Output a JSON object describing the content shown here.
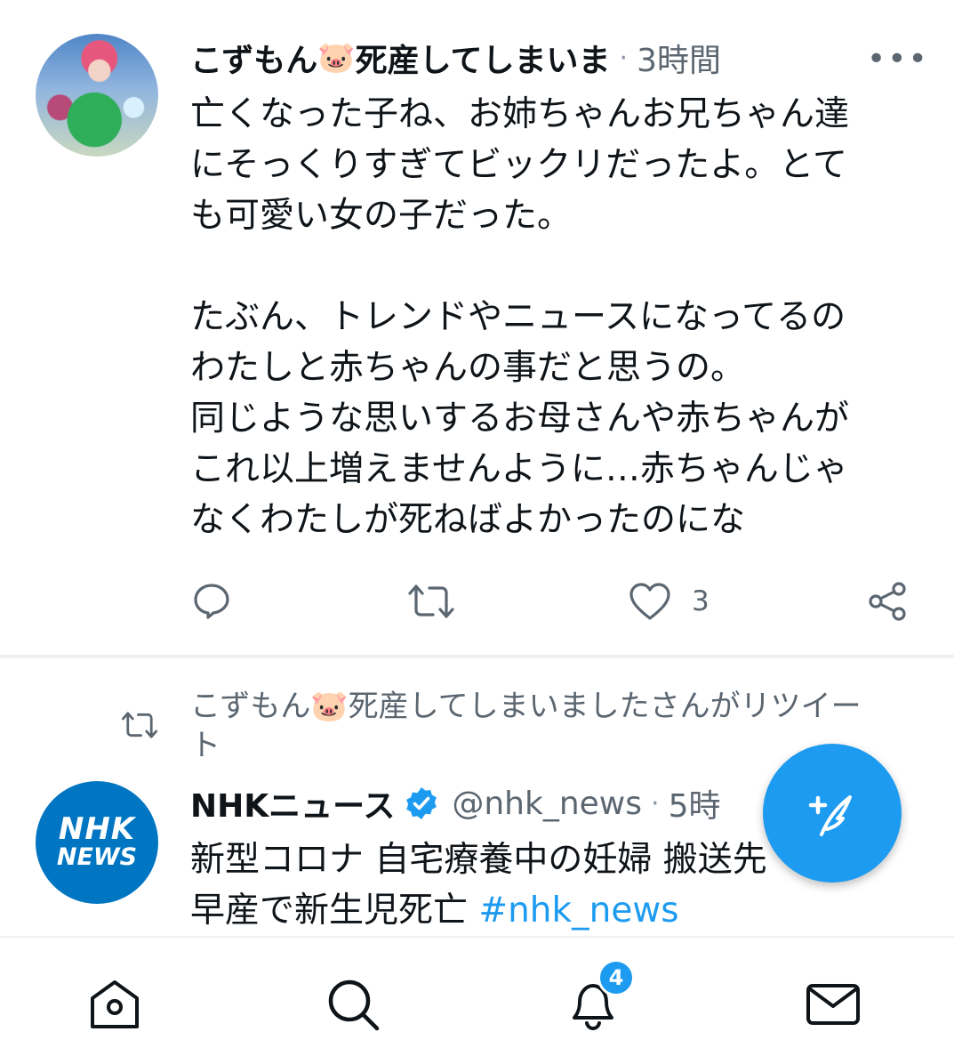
{
  "tweet1": {
    "display_name": "こずもん",
    "name_emoji": "🐷",
    "name_suffix": "死産してしまいま",
    "separator": "·",
    "time": "3時間",
    "more": "•••",
    "body": "亡くなった子ね、お姉ちゃんお兄ちゃん達\nにそっくりすぎてビックリだったよ。とて\nも可愛い女の子だった。\n\nたぶん、トレンドやニュースになってるの\nわたしと赤ちゃんの事だと思うの。\n同じような思いするお母さんや赤ちゃんが\nこれ以上増えませんように…赤ちゃんじゃ\nなくわたしが死ねばよかったのにな",
    "like_count": "3"
  },
  "retweet_context": {
    "line1": "こずもん🐷死産してしまいましたさんがリツイー",
    "line2": "ト"
  },
  "tweet2": {
    "avatar_line1": "NHK",
    "avatar_line2": "NEWS",
    "display_name": "NHKニュース",
    "handle": "@nhk_news",
    "separator": "·",
    "time": "5時",
    "body_line1": "新型コロナ 自宅療養中の妊婦 搬送先",
    "body_line2": "早産で新生児死亡 ",
    "hashtag": "#nhk_news"
  },
  "bottom_nav": {
    "notifications_badge": "4"
  },
  "colors": {
    "accent": "#1d9bf0",
    "secondary_text": "#5b6670",
    "nhk_blue": "#0075c2"
  }
}
